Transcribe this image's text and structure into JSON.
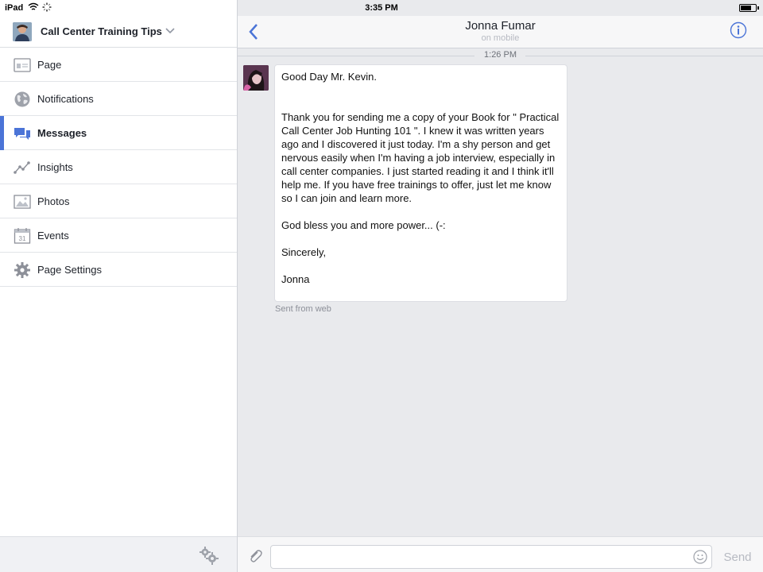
{
  "status_bar": {
    "device": "iPad",
    "time": "3:35 PM"
  },
  "sidebar": {
    "page_name": "Call Center Training Tips",
    "items": [
      {
        "label": "Page",
        "icon": "page-icon"
      },
      {
        "label": "Notifications",
        "icon": "globe-icon"
      },
      {
        "label": "Messages",
        "icon": "messages-icon",
        "active": true
      },
      {
        "label": "Insights",
        "icon": "insights-icon"
      },
      {
        "label": "Photos",
        "icon": "photos-icon"
      },
      {
        "label": "Events",
        "icon": "calendar-icon",
        "day": "31"
      },
      {
        "label": "Page Settings",
        "icon": "gear-icon"
      }
    ]
  },
  "thread": {
    "title": "Jonna Fumar",
    "subtitle": "on mobile",
    "time_divider": "1:26 PM",
    "message": {
      "greeting": "Good Day Mr. Kevin.",
      "body": "Thank you for sending me a copy of your Book for \" Practical Call Center Job Hunting 101 \". I knew it was written years ago and I discovered it just today. I'm a shy person and get nervous easily when I'm having a job interview, especially in call center companies. I just started reading it and I think it'll help me. If you have free trainings to offer, just let me know so I can join and learn more.",
      "blessing": "God bless you and more power... (-:",
      "closing": "Sincerely,",
      "signature": "Jonna"
    },
    "sent_from": "Sent from web"
  },
  "composer": {
    "value": "",
    "placeholder": "",
    "send_label": "Send"
  },
  "colors": {
    "accent": "#4b74d7",
    "background": "#e9eaed",
    "bubble": "#ffffff"
  }
}
